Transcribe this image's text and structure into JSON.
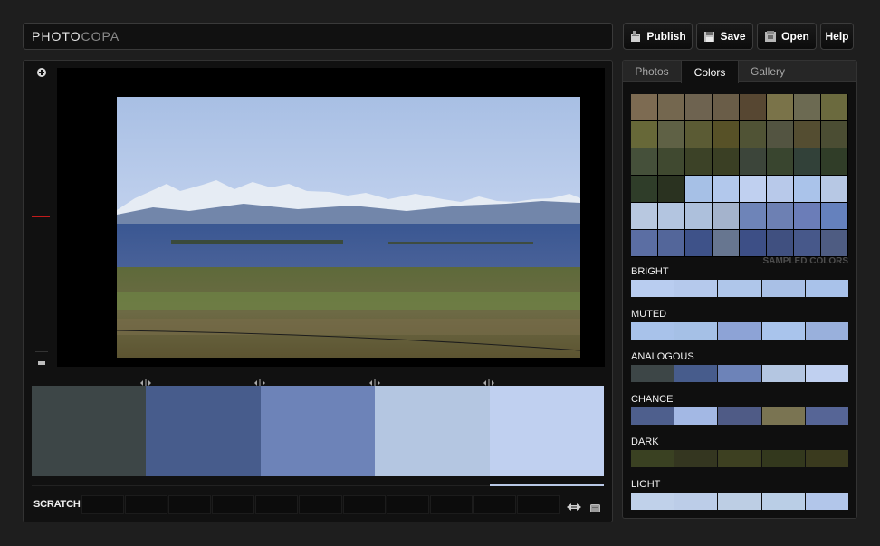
{
  "app": {
    "logo_main": "PHOTO",
    "logo_accent": "COPA"
  },
  "toolbar": {
    "publish_label": "Publish",
    "save_label": "Save",
    "open_label": "Open",
    "help_label": "Help"
  },
  "tabs": [
    {
      "label": "Photos",
      "active": false
    },
    {
      "label": "Colors",
      "active": true
    },
    {
      "label": "Gallery",
      "active": false
    }
  ],
  "selected_palette": [
    "#3d4647",
    "#475c8c",
    "#6d83b8",
    "#b4c6e1",
    "#c0d0f0"
  ],
  "scratch": {
    "label": "SCRATCH",
    "slots": 11
  },
  "sampled": {
    "label": "SAMPLED COLORS",
    "colors": [
      "#7d6b52",
      "#74674f",
      "#6e6350",
      "#6a5d48",
      "#574732",
      "#7a7349",
      "#6c6a52",
      "#6b6a3e",
      "#676838",
      "#5f6145",
      "#5b5b34",
      "#575127",
      "#505335",
      "#535441",
      "#544d31",
      "#4b4d33",
      "#45503a",
      "#404930",
      "#3c4227",
      "#3a3f24",
      "#3c453a",
      "#39452f",
      "#324139",
      "#303d28",
      "#2f3d29",
      "#2a3220",
      "#a6c0e6",
      "#b2c8ec",
      "#c0d0f0",
      "#b8c9ea",
      "#aac3ea",
      "#b7c8e4",
      "#b8c8e0",
      "#b3c5e0",
      "#adc0dc",
      "#a4b3cc",
      "#6e84b8",
      "#6d80b3",
      "#6b7db8",
      "#6581bd",
      "#5b6ea3",
      "#53669a",
      "#3e5289",
      "#677690",
      "#3d4f86",
      "#405080",
      "#47588a",
      "#4e5c82"
    ]
  },
  "palettes": [
    {
      "title": "BRIGHT",
      "colors": [
        "#b9cdf0",
        "#b5c9ec",
        "#afc6ea",
        "#a9c0e6",
        "#a9c2ea"
      ]
    },
    {
      "title": "MUTED",
      "colors": [
        "#a8c2ea",
        "#a5c0e6",
        "#8da3d6",
        "#a9c4ec",
        "#99b0dc"
      ]
    },
    {
      "title": "ANALOGOUS",
      "colors": [
        "#3d4647",
        "#475c8c",
        "#6d83b8",
        "#b4c6e1",
        "#c0d0f0"
      ]
    },
    {
      "title": "CHANCE",
      "colors": [
        "#4e5f8d",
        "#a3b8e4",
        "#4f5b86",
        "#7a7452",
        "#566596"
      ]
    },
    {
      "title": "DARK",
      "colors": [
        "#3a4122",
        "#343620",
        "#3d4021",
        "#33381d",
        "#3a3a1e"
      ]
    },
    {
      "title": "LIGHT",
      "colors": [
        "#c0d1ea",
        "#bccde8",
        "#bdcee4",
        "#bacee6",
        "#b2c6ea"
      ]
    }
  ]
}
